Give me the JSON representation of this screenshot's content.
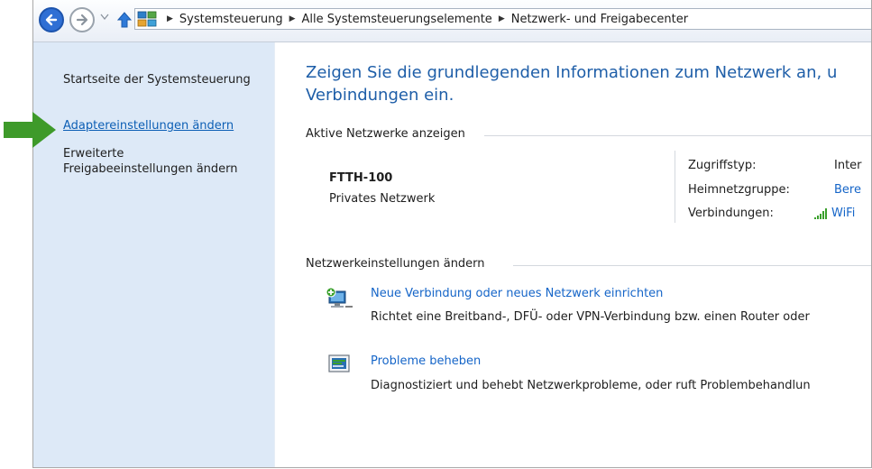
{
  "window": {
    "breadcrumb": [
      "Systemsteuerung",
      "Alle Systemsteuerungselemente",
      "Netzwerk- und Freigabecenter"
    ]
  },
  "sidebar": {
    "items": [
      {
        "label": "Startseite der Systemsteuerung"
      },
      {
        "label": "Adaptereinstellungen ändern"
      },
      {
        "label": "Erweiterte\nFreigabeeinstellungen ändern"
      }
    ]
  },
  "main": {
    "headline_line1": "Zeigen Sie die grundlegenden Informationen zum Netzwerk an, u",
    "headline_line2": "Verbindungen ein.",
    "active_networks_title": "Aktive Netzwerke anzeigen",
    "network": {
      "name": "FTTH-100",
      "type": "Privates Netzwerk",
      "props": [
        {
          "label": "Zugriffstyp:",
          "value": "Inter"
        },
        {
          "label": "Heimnetzgruppe:",
          "value": "Bere"
        },
        {
          "label": "Verbindungen:",
          "value": "WiFi"
        }
      ]
    },
    "settings_title": "Netzwerkeinstellungen ändern",
    "tasks": [
      {
        "link": "Neue Verbindung oder neues Netzwerk einrichten",
        "desc": "Richtet eine Breitband-, DFÜ- oder VPN-Verbindung bzw. einen Router oder"
      },
      {
        "link": "Probleme beheben",
        "desc": "Diagnostiziert und behebt Netzwerkprobleme, oder ruft Problembehandlun"
      }
    ]
  },
  "colors": {
    "accent_blue": "#1565c8",
    "sidebar_bg": "#dde9f7",
    "pointer_green": "#3e9a2a"
  }
}
